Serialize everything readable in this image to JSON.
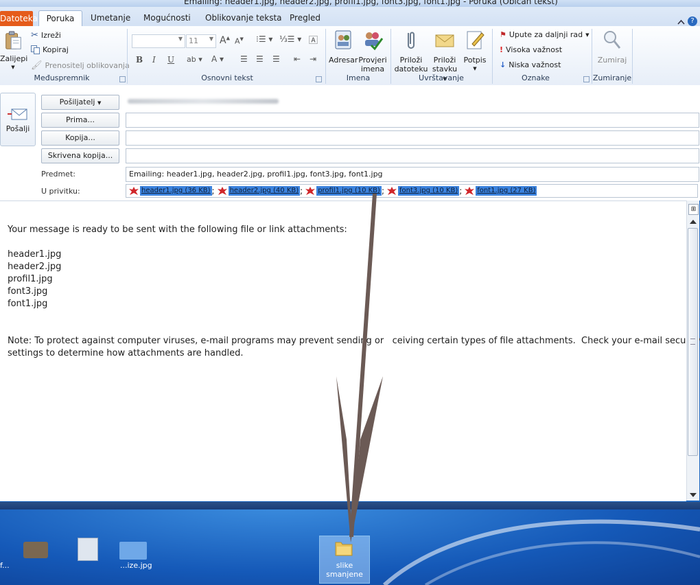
{
  "window": {
    "title": "Emailing: header1.jpg, header2.jpg, profil1.jpg, font3.jpg, font1.jpg - Poruka (Običan tekst)"
  },
  "tabs": [
    "Datoteka",
    "Poruka",
    "Umetanje",
    "Mogućnosti",
    "Oblikovanje teksta",
    "Pregled"
  ],
  "ribbon": {
    "clipboard": {
      "paste": "Zalijepi",
      "cut": "Izreži",
      "copy": "Kopiraj",
      "format_painter": "Prenositelj oblikovanja",
      "label": "Međuspremnik"
    },
    "basic_text": {
      "font_size": "11",
      "bold": "B",
      "italic": "I",
      "underline": "U",
      "label": "Osnovni tekst"
    },
    "names": {
      "address_book": "Adresar",
      "check_names_1": "Provjeri",
      "check_names_2": "imena",
      "label": "Imena"
    },
    "include": {
      "attach_file_1": "Priloži",
      "attach_file_2": "datoteku",
      "attach_item_1": "Priloži",
      "attach_item_2": "stavku",
      "signature": "Potpis",
      "label": "Uvrštavanje"
    },
    "tags": {
      "follow_up": "Upute za daljnji rad",
      "high": "Visoka važnost",
      "low": "Niska važnost",
      "label": "Oznake"
    },
    "zoom": {
      "zoom": "Zumiraj",
      "label": "Zumiranje"
    }
  },
  "compose": {
    "send": "Pošalji",
    "from": "Pošiljatelj",
    "to": "Prima...",
    "cc": "Kopija...",
    "bcc": "Skrivena kopija...",
    "subject_label": "Predmet:",
    "subject": "Emailing: header1.jpg, header2.jpg, profil1.jpg, font3.jpg, font1.jpg",
    "attach_label": "U privitku:",
    "attachments": [
      {
        "name": "header1.jpg (36 KB)"
      },
      {
        "name": "header2.jpg (40 KB)"
      },
      {
        "name": "profil1.jpg (10 KB)"
      },
      {
        "name": "font3.jpg (10 KB)"
      },
      {
        "name": "font1.jpg (27 KB)"
      }
    ]
  },
  "body": {
    "intro": "Your message is ready to be sent with the following file or link attachments:",
    "files": [
      "header1.jpg",
      "header2.jpg",
      "profil1.jpg",
      "font3.jpg",
      "font1.jpg"
    ],
    "note_line1": "Note: To protect against computer viruses, e-mail programs may prevent sending or   ceiving certain types of file attachments.  Check your e-mail security",
    "note_line2": "settings to determine how attachments are handled."
  },
  "desktop": {
    "folder_line1": "slike",
    "folder_line2": "smanjene",
    "icon_label_left": "f...",
    "icon_label_mid": "...ize.jpg"
  },
  "colors": {
    "file_tab": "#e55b1b",
    "selection": "#3b82dd",
    "arrow": "#6b5a55"
  }
}
